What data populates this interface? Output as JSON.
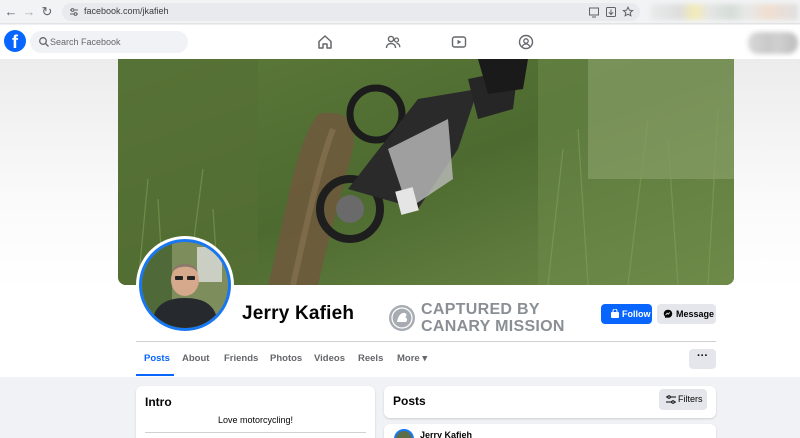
{
  "browser": {
    "url": "facebook.com/jkafieh"
  },
  "header": {
    "search_placeholder": "Search Facebook",
    "nav_icons": [
      "home-icon",
      "friends-icon",
      "watch-icon",
      "groups-icon"
    ]
  },
  "profile": {
    "name": "Jerry Kafieh",
    "stamp_line1": "CAPTURED BY",
    "stamp_line2": "CANARY MISSION",
    "follow_label": "Follow",
    "message_label": "Message",
    "more_label": "···"
  },
  "tabs": [
    {
      "label": "Posts",
      "active": true
    },
    {
      "label": "About"
    },
    {
      "label": "Friends"
    },
    {
      "label": "Photos"
    },
    {
      "label": "Videos"
    },
    {
      "label": "Reels"
    },
    {
      "label": "More ▾"
    }
  ],
  "intro": {
    "title": "Intro",
    "bio": "Love motorcycling!"
  },
  "posts": {
    "title": "Posts",
    "filters_label": "Filters",
    "first_post_author": "Jerry Kafieh"
  },
  "colors": {
    "brand": "#0866ff",
    "stamp_gray": "#8a8f96"
  }
}
